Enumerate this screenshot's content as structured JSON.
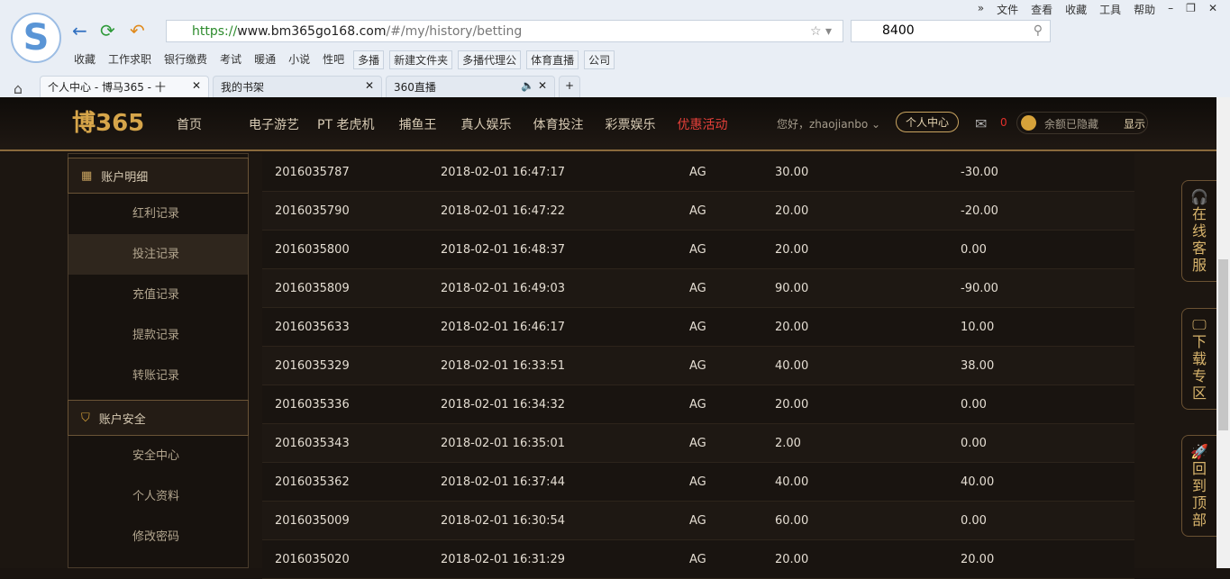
{
  "browser": {
    "url_scheme": "https://",
    "url_host": "www.bm365go168.com",
    "url_path": "/#/my/history/betting",
    "search": "8400",
    "menu": [
      "»",
      "文件",
      "查看",
      "收藏",
      "工具",
      "帮助"
    ],
    "bookmarks": [
      "收藏",
      "工作求职",
      "银行缴费",
      "考试",
      "暖通",
      "小说",
      "性吧",
      "多播",
      "新建文件夹",
      "多播代理公",
      "体育直播",
      "公司"
    ],
    "tabs": [
      {
        "label": "个人中心 - 博马365 - 十"
      },
      {
        "label": "我的书架"
      },
      {
        "label": "360直播"
      }
    ]
  },
  "site": {
    "logo": "博365",
    "nav": [
      "首页",
      "电子游艺",
      "PT 老虎机",
      "捕鱼王",
      "真人娱乐",
      "体育投注",
      "彩票娱乐",
      "优惠活动"
    ],
    "greeting": "您好，zhaojianbo",
    "personal_center": "个人中心",
    "mail_count": "0",
    "balance_hidden": "余额已隐藏",
    "show": "显示"
  },
  "sidebar": {
    "account_detail": "账户明细",
    "detail_items": [
      "红利记录",
      "投注记录",
      "充值记录",
      "提款记录",
      "转账记录"
    ],
    "account_security": "账户安全",
    "security_items": [
      "安全中心",
      "个人资料",
      "修改密码"
    ]
  },
  "rows": [
    [
      "2016035787",
      "2018-02-01 16:47:17",
      "AG",
      "30.00",
      "-30.00"
    ],
    [
      "2016035790",
      "2018-02-01 16:47:22",
      "AG",
      "20.00",
      "-20.00"
    ],
    [
      "2016035800",
      "2018-02-01 16:48:37",
      "AG",
      "20.00",
      "0.00"
    ],
    [
      "2016035809",
      "2018-02-01 16:49:03",
      "AG",
      "90.00",
      "-90.00"
    ],
    [
      "2016035633",
      "2018-02-01 16:46:17",
      "AG",
      "20.00",
      "10.00"
    ],
    [
      "2016035329",
      "2018-02-01 16:33:51",
      "AG",
      "40.00",
      "38.00"
    ],
    [
      "2016035336",
      "2018-02-01 16:34:32",
      "AG",
      "20.00",
      "0.00"
    ],
    [
      "2016035343",
      "2018-02-01 16:35:01",
      "AG",
      "2.00",
      "0.00"
    ],
    [
      "2016035362",
      "2018-02-01 16:37:44",
      "AG",
      "40.00",
      "40.00"
    ],
    [
      "2016035009",
      "2018-02-01 16:30:54",
      "AG",
      "60.00",
      "0.00"
    ],
    [
      "2016035020",
      "2018-02-01 16:31:29",
      "AG",
      "20.00",
      "20.00"
    ]
  ],
  "float": {
    "service": "在线客服",
    "download": "下载专区",
    "top": "回到顶部"
  }
}
